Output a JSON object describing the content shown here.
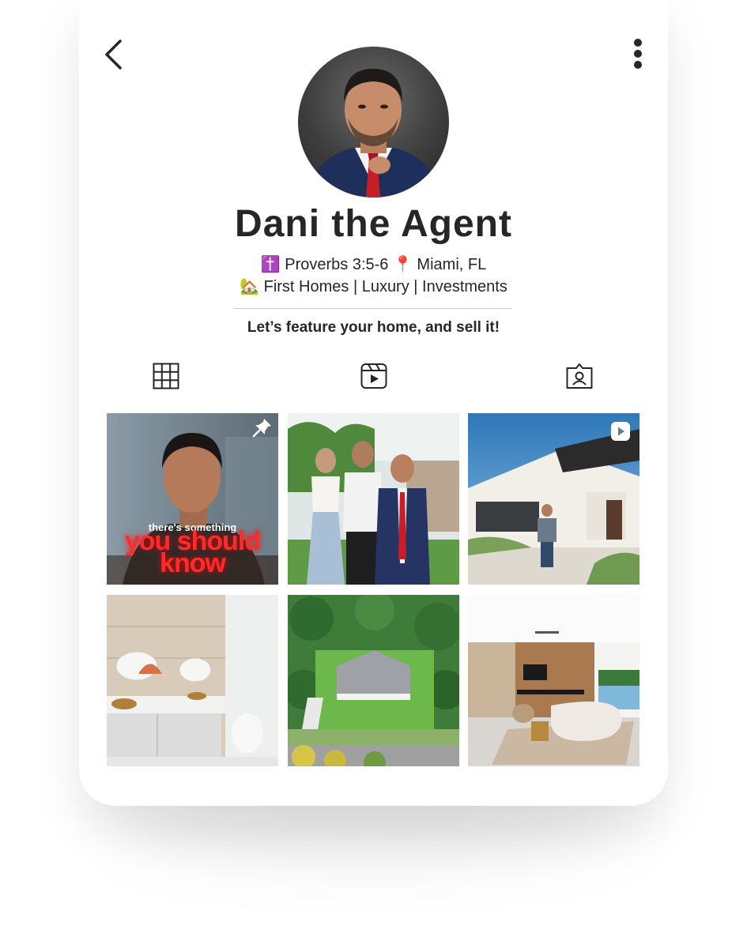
{
  "profile": {
    "name": "Dani the Agent",
    "bio_line1": "✝️ Proverbs 3:5-6 📍 Miami, FL",
    "bio_line2": "🏡 First Homes | Luxury | Investments",
    "tagline": "Let’s feature your home, and sell it!"
  },
  "nav": {
    "back_icon": "chevron-left-icon",
    "more_icon": "more-vertical-icon"
  },
  "tabs": [
    {
      "name": "posts",
      "icon": "grid-icon"
    },
    {
      "name": "reels",
      "icon": "reels-icon"
    },
    {
      "name": "tagged",
      "icon": "tagged-icon"
    }
  ],
  "posts": {
    "tile1_small_text": "there's something",
    "tile1_big_line1": "you should",
    "tile1_big_line2": "know"
  },
  "colors": {
    "text": "#262626",
    "accent_red": "#ff2a2a",
    "divider": "#c8c8c8"
  }
}
